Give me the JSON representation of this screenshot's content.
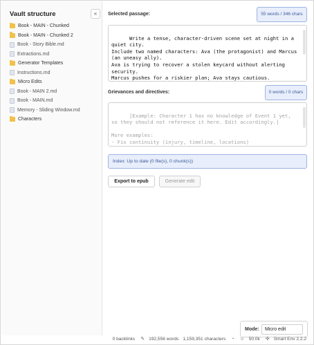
{
  "sidebar": {
    "title": "Vault structure",
    "collapse_glyph": "«",
    "items": [
      {
        "type": "folder",
        "label": "Book - MAIN - Chunked"
      },
      {
        "type": "folder",
        "label": "Book - MAIN - Chunked 2"
      },
      {
        "type": "file",
        "label": "Book - Story Bible.md"
      },
      {
        "type": "file",
        "label": "Extractions.md"
      },
      {
        "type": "folder",
        "label": "Generator Templates"
      },
      {
        "type": "file",
        "label": "Instructions.md"
      },
      {
        "type": "folder",
        "label": "Micro Edits"
      },
      {
        "type": "file",
        "label": "Book - MAIN 2.md"
      },
      {
        "type": "file",
        "label": "Book - MAIN.md"
      },
      {
        "type": "file",
        "label": "Memory - Sliding Window.md"
      },
      {
        "type": "folder",
        "label": "Characters"
      }
    ]
  },
  "passage": {
    "label": "Selected passage:",
    "count": "55 words / 346 chars",
    "text": "Write a tense, character-driven scene set at night in a quiet city.\nInclude two named characters: Ava (the protagonist) and Marcus (an uneasy ally).\nAva is trying to recover a stolen keycard without alerting security.\nMarcus pushes for a riskier plan; Ava stays cautious.\nEnd with a cliffhanger discovery (a hidden message or unexpected witness)."
  },
  "grievances": {
    "label": "Grievances and directives:",
    "count": "0 words / 0 chars",
    "placeholder": "[Example: Character 1 has no knowledge of Event 1 yet, so they should not reference it here. Edit accordingly.]\n\nMore examples:\n- Fix continuity (injury, timeline, locations)\n- Fix POV leaks\n- Match tone/voice to the surrounding context"
  },
  "index_status": "Index: Up to date (0 file(s), 0 chunk(s))",
  "buttons": {
    "export": "Export to epub",
    "generate": "Generate edit"
  },
  "mode": {
    "label": "Mode:",
    "value": "Micro edit"
  },
  "statusbar": {
    "backlinks": "0 backlinks",
    "words": "192,556 words",
    "characters": "1,159,351 characters",
    "tokens": "50.0k",
    "env": "Smart Env 2.2.2"
  }
}
